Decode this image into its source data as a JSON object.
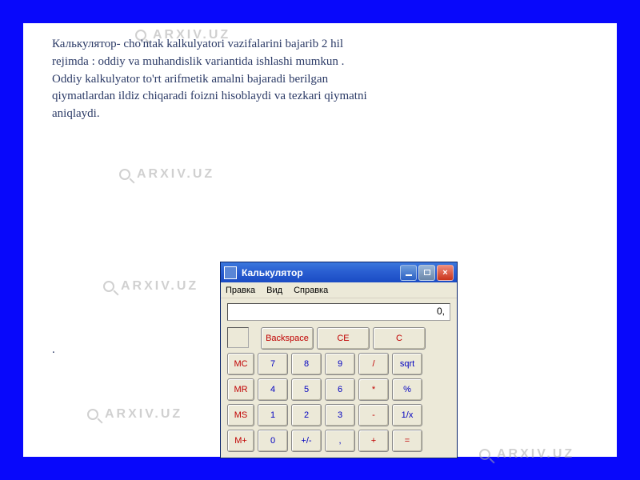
{
  "watermark": "ARXIV.UZ",
  "description": "Калькулятор- cho'ntak kalkulyatori vazifalarini bajarib  2 hil rejimda : oddiy va muhandislik variantida ishlashi mumkun . Oddiy kalkulyator to'rt arifmetik amalni  bajaradi  berilgan qiymatlardan  ildiz   chiqaradi  foizni  hisoblaydi va tezkari  qiymatni  aniqlaydi.",
  "dot": ".",
  "calc": {
    "title": "Калькулятор",
    "menu": {
      "edit": "Правка",
      "view": "Вид",
      "help": "Справка"
    },
    "display": "0,",
    "toprow": {
      "backspace": "Backspace",
      "ce": "CE",
      "c": "C"
    },
    "mem": {
      "mc": "MC",
      "mr": "MR",
      "ms": "MS",
      "mplus": "M+"
    },
    "keys": {
      "7": "7",
      "8": "8",
      "9": "9",
      "div": "/",
      "sqrt": "sqrt",
      "4": "4",
      "5": "5",
      "6": "6",
      "mul": "*",
      "pct": "%",
      "1": "1",
      "2": "2",
      "3": "3",
      "sub": "-",
      "inv": "1/x",
      "0": "0",
      "pm": "+/-",
      "dot": ",",
      "add": "+",
      "eq": "="
    }
  }
}
